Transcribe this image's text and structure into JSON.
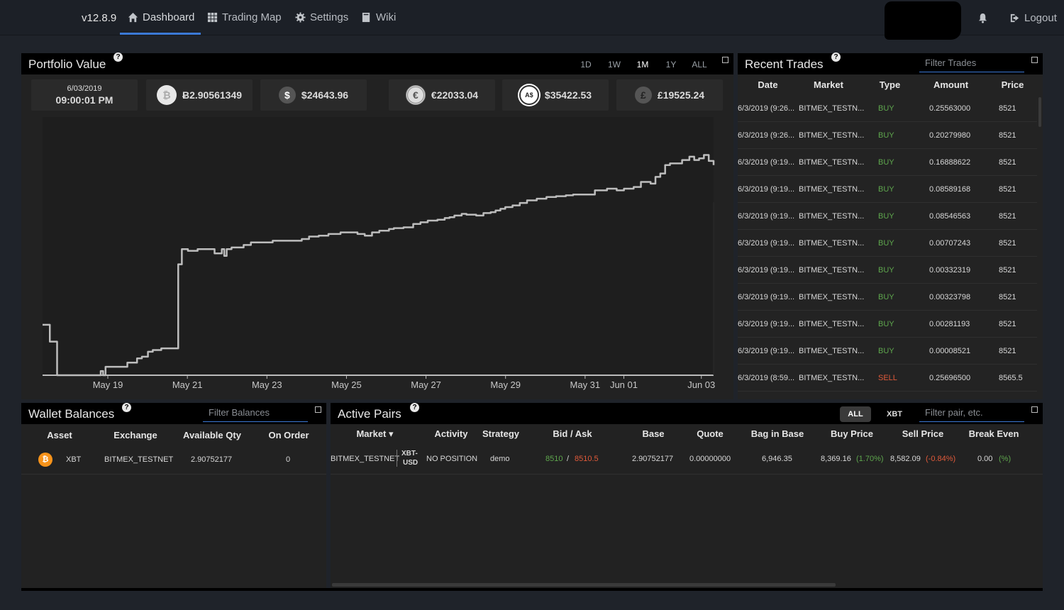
{
  "nav": {
    "version": "v12.8.9",
    "items": [
      {
        "label": "Dashboard",
        "icon": "home-icon"
      },
      {
        "label": "Trading Map",
        "icon": "grid-icon"
      },
      {
        "label": "Settings",
        "icon": "gear-icon"
      },
      {
        "label": "Wiki",
        "icon": "book-icon"
      }
    ],
    "logout": "Logout"
  },
  "portfolio": {
    "title": "Portfolio Value",
    "ranges": [
      "1D",
      "1W",
      "1M",
      "1Y",
      "ALL"
    ],
    "active_range": "1M",
    "date": "6/03/2019",
    "time": "09:00:01 PM",
    "values": [
      {
        "icon": "bitcoin-icon",
        "text": "Ƀ2.90561349"
      },
      {
        "icon": "dollar-icon",
        "text": "$24643.96"
      },
      {
        "icon": "euro-icon",
        "text": "€22033.04"
      },
      {
        "icon": "aud-icon",
        "text": "$35422.53"
      },
      {
        "icon": "pound-icon",
        "text": "£19525.24"
      }
    ]
  },
  "chart_data": {
    "type": "line",
    "x_ticks": [
      "May 19",
      "May 21",
      "May 23",
      "May 25",
      "May 27",
      "May 29",
      "May 31",
      "Jun 01",
      "Jun 03"
    ],
    "series": [
      {
        "x": [
          0,
          0.3,
          0.6,
          0.9,
          1.5,
          2.2,
          2.4,
          2.5,
          2.6,
          3.0,
          3.5,
          3.9,
          4.1,
          4.35,
          4.55,
          4.9,
          5.4,
          5.6,
          5.75,
          6.0,
          6.4,
          6.9,
          7.1,
          7.4,
          7.5,
          7.6,
          7.8,
          8.3,
          8.6,
          9.1,
          9.5,
          9.7,
          10.0,
          10.7,
          11.0,
          11.4,
          11.8,
          12.3,
          12.6,
          13.0,
          13.3,
          13.6,
          13.9,
          14.3,
          14.5,
          14.9,
          15.3,
          15.6,
          15.9,
          16.3,
          16.6,
          16.8,
          17.0,
          17.3,
          17.5,
          17.9,
          18.2,
          18.5,
          18.7,
          18.9,
          19.1,
          19.4,
          19.7,
          20.0,
          20.4,
          20.8,
          21.2,
          21.6,
          21.9,
          22.3,
          22.8,
          23.3,
          23.7,
          24.0,
          24.4,
          24.7,
          25.1,
          25.3,
          25.5,
          25.7,
          25.9,
          26.1,
          26.4,
          26.7,
          26.9,
          27.1,
          27.3,
          27.5,
          27.7
        ],
        "y": [
          24.0,
          23.8,
          23.4,
          23.4,
          23.4,
          23.4,
          23.45,
          23.4,
          23.5,
          23.5,
          23.55,
          23.6,
          23.62,
          23.68,
          23.7,
          23.72,
          23.72,
          24.72,
          24.9,
          24.88,
          24.9,
          24.9,
          24.85,
          24.9,
          24.82,
          24.9,
          24.92,
          24.95,
          24.98,
          24.98,
          25.0,
          25.0,
          25.0,
          25.02,
          25.05,
          25.06,
          25.08,
          25.1,
          25.1,
          25.08,
          25.06,
          25.1,
          25.12,
          25.14,
          25.15,
          25.16,
          25.2,
          25.22,
          25.24,
          25.25,
          25.27,
          25.28,
          25.3,
          25.32,
          25.31,
          25.3,
          25.33,
          25.34,
          25.36,
          25.38,
          25.4,
          25.42,
          25.45,
          25.48,
          25.5,
          25.52,
          25.53,
          25.54,
          25.55,
          25.55,
          25.6,
          25.62,
          25.6,
          25.62,
          25.64,
          25.7,
          25.68,
          25.76,
          25.8,
          25.9,
          25.92,
          25.92,
          25.96,
          26.0,
          25.96,
          25.98,
          26.02,
          25.95,
          25.9
        ]
      }
    ],
    "grid": false
  },
  "trades": {
    "title": "Recent Trades",
    "filter_placeholder": "Filter Trades",
    "columns": [
      "Date",
      "Market",
      "Type",
      "Amount",
      "Price"
    ],
    "rows": [
      [
        "6/3/2019 (9:26...",
        "BITMEX_TESTN...",
        "BUY",
        "0.25563000",
        "8521"
      ],
      [
        "6/3/2019 (9:26...",
        "BITMEX_TESTN...",
        "BUY",
        "0.20279980",
        "8521"
      ],
      [
        "6/3/2019 (9:19...",
        "BITMEX_TESTN...",
        "BUY",
        "0.16888622",
        "8521"
      ],
      [
        "6/3/2019 (9:19...",
        "BITMEX_TESTN...",
        "BUY",
        "0.08589168",
        "8521"
      ],
      [
        "6/3/2019 (9:19...",
        "BITMEX_TESTN...",
        "BUY",
        "0.08546563",
        "8521"
      ],
      [
        "6/3/2019 (9:19...",
        "BITMEX_TESTN...",
        "BUY",
        "0.00707243",
        "8521"
      ],
      [
        "6/3/2019 (9:19...",
        "BITMEX_TESTN...",
        "BUY",
        "0.00332319",
        "8521"
      ],
      [
        "6/3/2019 (9:19...",
        "BITMEX_TESTN...",
        "BUY",
        "0.00323798",
        "8521"
      ],
      [
        "6/3/2019 (9:19...",
        "BITMEX_TESTN...",
        "BUY",
        "0.00281193",
        "8521"
      ],
      [
        "6/3/2019 (9:19...",
        "BITMEX_TESTN...",
        "BUY",
        "0.00008521",
        "8521"
      ],
      [
        "6/3/2019 (8:59...",
        "BITMEX_TESTN...",
        "SELL",
        "0.25696500",
        "8565.5"
      ]
    ]
  },
  "wallet": {
    "title": "Wallet Balances",
    "filter_placeholder": "Filter Balances",
    "columns": [
      "Asset",
      "Exchange",
      "Available Qty",
      "On Order"
    ],
    "rows": [
      {
        "icon": "bitcoin-icon",
        "asset": "XBT",
        "exchange": "BITMEX_TESTNET",
        "qty": "2.90752177",
        "on_order": "0"
      }
    ]
  },
  "pairs": {
    "title": "Active Pairs",
    "filters": [
      "ALL",
      "XBT"
    ],
    "filter_placeholder": "Filter pair, etc.",
    "columns": [
      "Market ▾",
      "Activity",
      "Strategy",
      "Bid / Ask",
      "Base",
      "Quote",
      "Bag in Base",
      "Buy Price",
      "Sell Price",
      "Break Even"
    ],
    "row": {
      "exchange": "BITMEX_TESTNET",
      "pair_top": "XBT-",
      "pair_bottom": "USD",
      "activity": "NO POSITION",
      "strategy": "demo",
      "bid": "8510",
      "sep": "/",
      "ask": "8510.5",
      "base": "2.90752177",
      "quote": "0.00000000",
      "bag": "6,946.35",
      "buy_price": "8,369.16",
      "buy_pct": "(1.70%)",
      "sell_price": "8,582.09",
      "sell_pct": "(-0.84%)",
      "break_even": "0.00",
      "be_pct": "(%)"
    }
  },
  "colors": {
    "accent": "#3b79d6",
    "buy": "#5ea64d",
    "sell": "#e05a3a",
    "bitcoin": "#f7931a"
  }
}
